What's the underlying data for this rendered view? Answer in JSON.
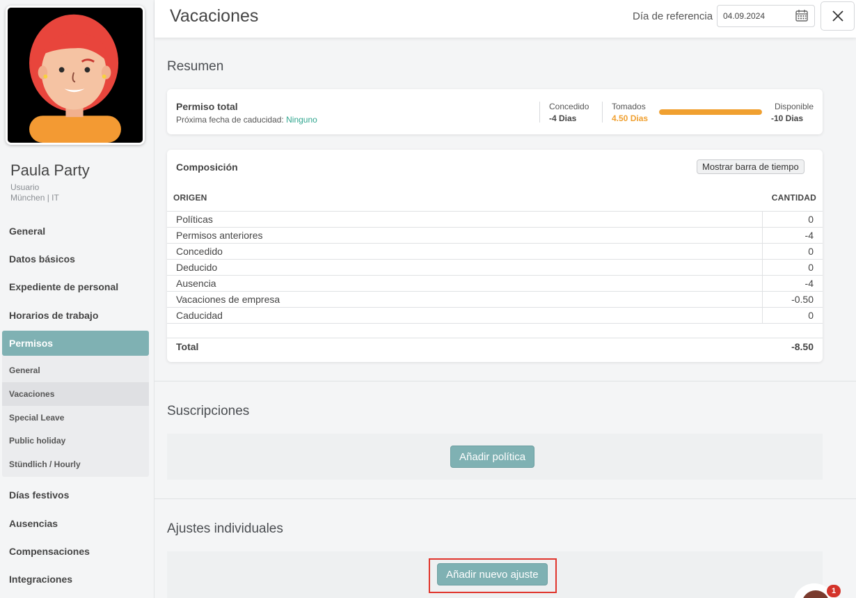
{
  "user": {
    "name": "Paula Party",
    "role": "Usuario",
    "location": "München | IT"
  },
  "sidebar": {
    "items": [
      {
        "label": "General"
      },
      {
        "label": "Datos básicos"
      },
      {
        "label": "Expediente de personal"
      },
      {
        "label": "Horarios de trabajo"
      },
      {
        "label": "Permisos",
        "active": true
      },
      {
        "label": "Días festivos"
      },
      {
        "label": "Ausencias"
      },
      {
        "label": "Compensaciones"
      },
      {
        "label": "Integraciones"
      }
    ],
    "sub_items": [
      {
        "label": "General"
      },
      {
        "label": "Vacaciones",
        "active": true
      },
      {
        "label": "Special Leave"
      },
      {
        "label": "Public holiday"
      },
      {
        "label": "Stündlich / Hourly"
      }
    ]
  },
  "header": {
    "title": "Vacaciones",
    "ref_label": "Día de referencia",
    "ref_date": "04.09.2024",
    "calendar_icon": "calendar-icon",
    "close_icon": "close-icon"
  },
  "summary": {
    "title": "Resumen",
    "card": {
      "title": "Permiso total",
      "expiry_label": "Próxima fecha de caducidad:",
      "expiry_value": "Ninguno",
      "granted_label": "Concedido",
      "granted_value": "-4 Dias",
      "taken_label": "Tomados",
      "taken_value": "4.50 Dias",
      "taken_fraction": 1.0,
      "available_label": "Disponible",
      "available_value": "-10 Dias"
    }
  },
  "composition": {
    "title": "Composición",
    "timeline_button": "Mostrar barra de tiempo",
    "col_origin": "ORIGEN",
    "col_amount": "CANTIDAD",
    "rows": [
      {
        "origin": "Políticas",
        "amount": "0"
      },
      {
        "origin": "Permisos anteriores",
        "amount": "-4"
      },
      {
        "origin": "Concedido",
        "amount": "0"
      },
      {
        "origin": "Deducido",
        "amount": "0"
      },
      {
        "origin": "Ausencia",
        "amount": "-4"
      },
      {
        "origin": "Vacaciones de empresa",
        "amount": "-0.50"
      },
      {
        "origin": "Caducidad",
        "amount": "0"
      }
    ],
    "total_label": "Total",
    "total_value": "-8.50"
  },
  "subscriptions": {
    "title": "Suscripciones",
    "add_button": "Añadir política"
  },
  "adjustments": {
    "title": "Ajustes individuales",
    "add_button": "Añadir nuevo ajuste"
  },
  "chat": {
    "badge_count": "1"
  },
  "colors": {
    "accent": "#7fb1b3",
    "orange": "#f0a030",
    "green": "#2fa58e",
    "highlight": "#e0342b"
  }
}
